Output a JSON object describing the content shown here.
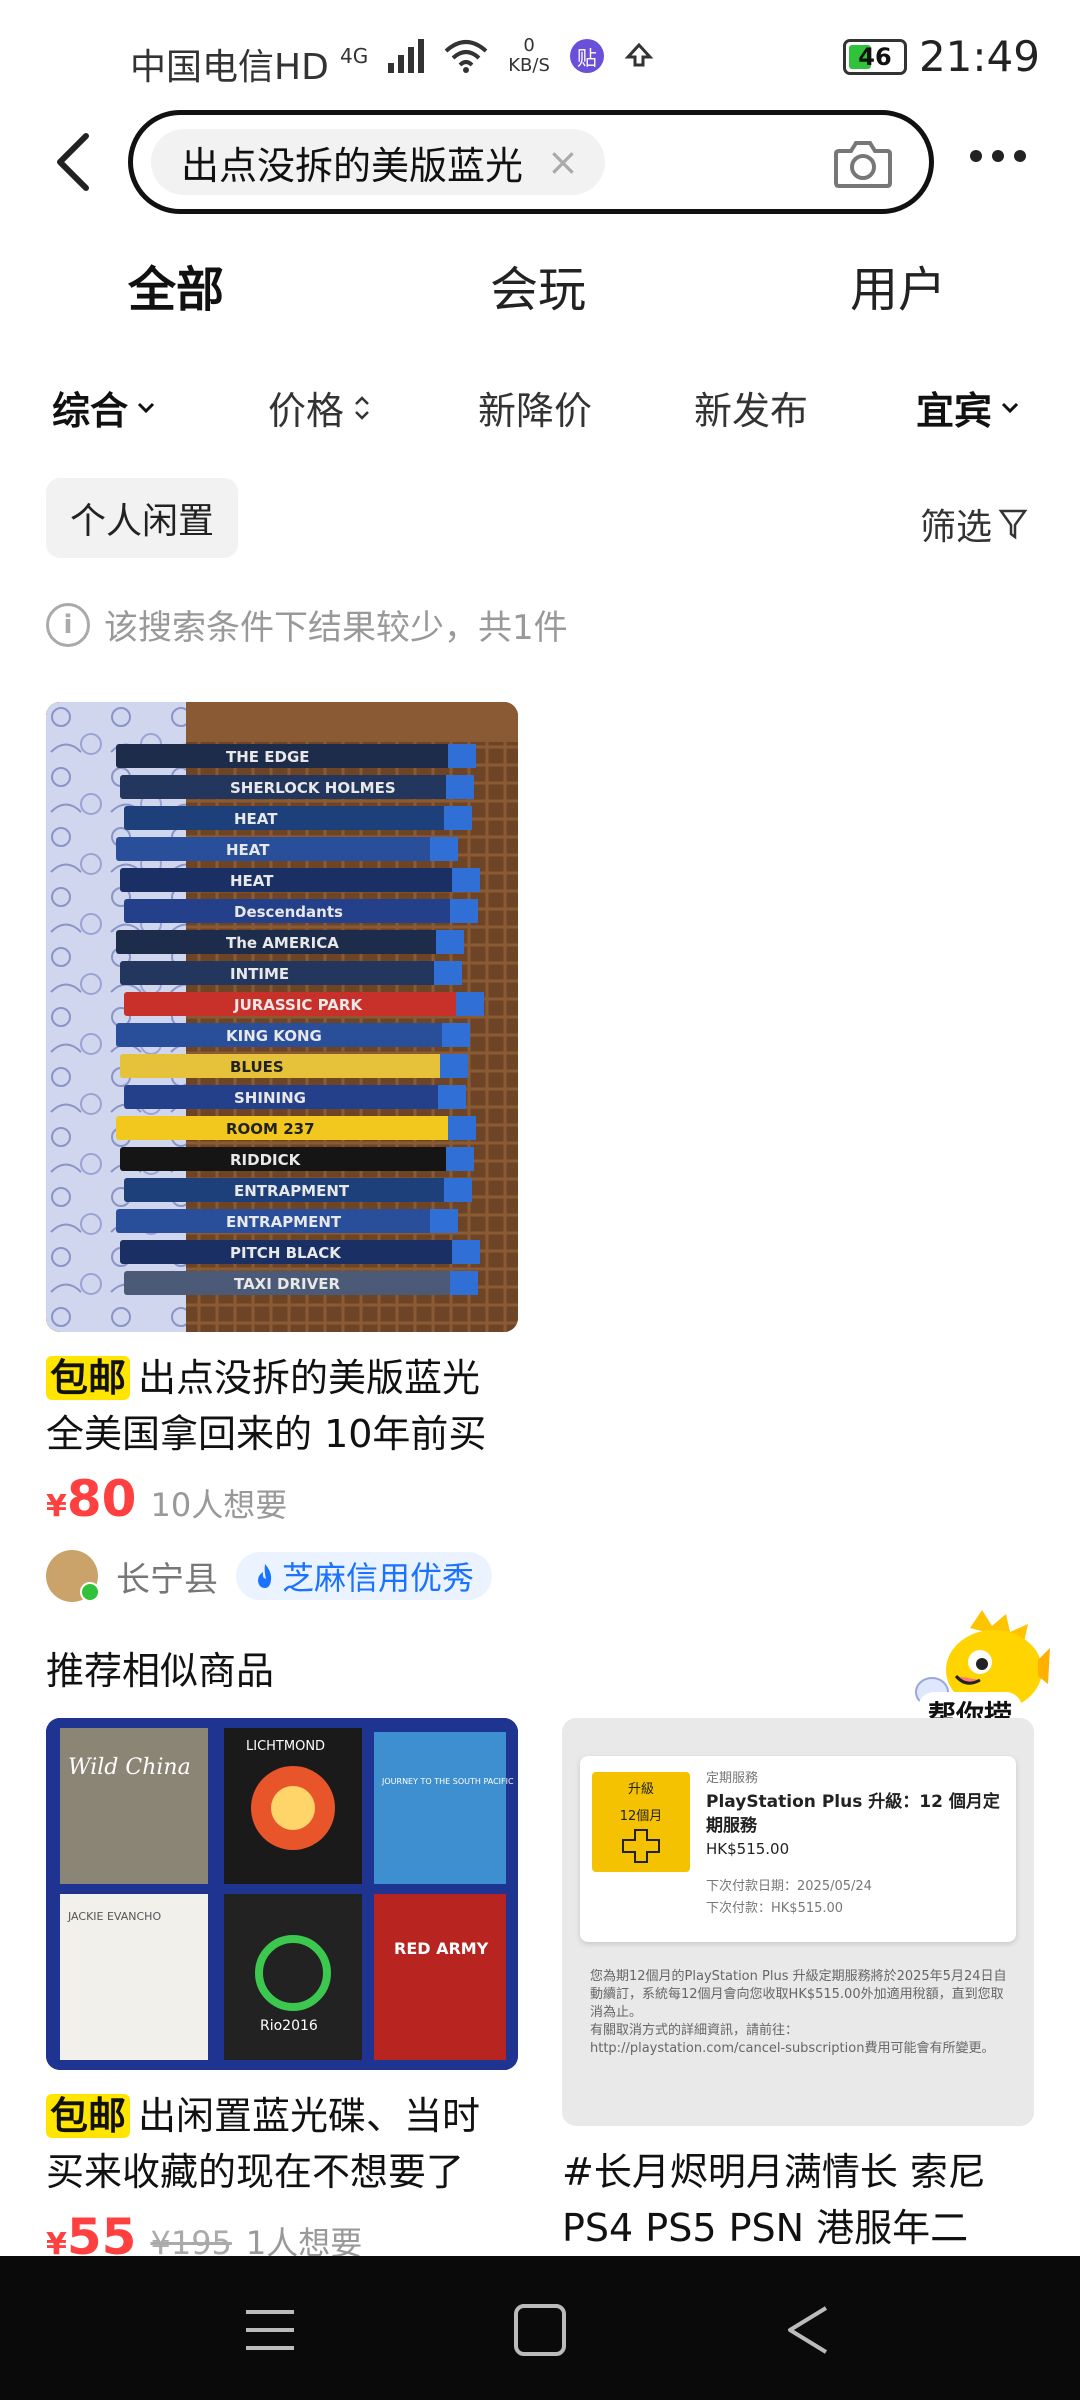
{
  "status_bar": {
    "carrier": "中国电信HD",
    "net": "4G",
    "speed_value": "0",
    "speed_unit": "KB/S",
    "badge": "贴",
    "battery": "46",
    "time": "21:49"
  },
  "search": {
    "query": "出点没拆的美版蓝光",
    "clear_icon": "×"
  },
  "top_tabs": [
    {
      "label": "全部",
      "active": true
    },
    {
      "label": "会玩",
      "active": false
    },
    {
      "label": "用户",
      "active": false
    }
  ],
  "sort": {
    "comprehensive": "综合",
    "price": "价格",
    "price_drop": "新降价",
    "new_release": "新发布",
    "location": "宜宾"
  },
  "filters": {
    "personal_chip": "个人闲置",
    "filter_label": "筛选"
  },
  "notice": {
    "icon": "i",
    "text": "该搜索条件下结果较少，共1件"
  },
  "product": {
    "tag": "包邮",
    "title": "出点没拆的美版蓝光全美国拿回来的 10年前买",
    "currency": "¥",
    "price": "80",
    "want": "10人想要",
    "location": "长宁县",
    "credit": "芝麻信用优秀",
    "spines": [
      "THE EDGE",
      "SHERLOCK HOLMES",
      "HEAT",
      "HEAT",
      "HEAT",
      "Descendants",
      "The AMERICA",
      "INTIME",
      "JURASSIC PARK",
      "KING KONG",
      "BLUES",
      "SHINING",
      "ROOM 237",
      "RIDDICK",
      "ENTRAPMENT",
      "ENTRAPMENT",
      "PITCH BLACK",
      "TAXI DRIVER"
    ]
  },
  "similar": {
    "section_title": "推荐相似商品",
    "mascot_label": "帮你捞",
    "card1": {
      "tag": "包邮",
      "title": "出闲置蓝光碟、当时买来收藏的现在不想要了",
      "currency": "¥",
      "price": "55",
      "orig_price": "¥195",
      "want": "1人想要",
      "covers": [
        "Wild China",
        "LICHTMOND",
        "JOURNEY TO THE SOUTH PACIFIC",
        "JACKIE EVANCHO",
        "Rio2016",
        "RED ARMY"
      ]
    },
    "card2": {
      "title": "#长月烬明月满情长 索尼PS4 PS5 PSN 港服年二",
      "ps_badge_top": "升級",
      "ps_badge_mid": "12個月",
      "ps_service": "定期服務",
      "ps_title": "PlayStation Plus 升級：12 個月定期服務",
      "ps_price": "HK$515.00",
      "ps_next_date": "下次付款日期：2025/05/24",
      "ps_next_pay": "下次付款：HK$515.00",
      "ps_note1": "您為期12個月的PlayStation Plus 升級定期服務將於2025年5月24日自動續訂，系統每12個月會向您收取HK$515.00外加適用稅額，直到您取消為止。",
      "ps_note2": "有關取消方式的詳細資訊，請前往：",
      "ps_note3": "http://playstation.com/cancel-subscription費用可能會有所變更。"
    }
  },
  "colors": {
    "accent_yellow": "#ffe500",
    "price_red": "#ff4040",
    "credit_blue": "#1a72ff"
  }
}
